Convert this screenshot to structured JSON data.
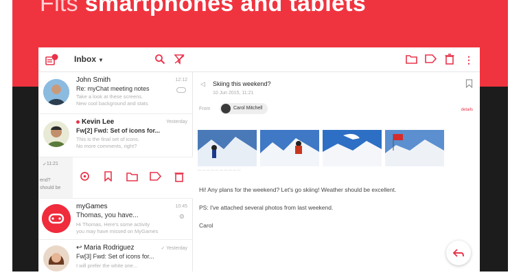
{
  "banner": {
    "headline_light": "Fits",
    "headline_bold": "smartphones and tablets"
  },
  "toolbar": {
    "folder_label": "Inbox",
    "icons": [
      "compose-badge-icon",
      "search-icon",
      "filter-icon",
      "folder-icon",
      "label-icon",
      "trash-icon",
      "more-icon"
    ]
  },
  "messages": [
    {
      "sender": "John Smith",
      "time": "12:12",
      "subject": "Re: myChat meeting notes",
      "preview_1": "Take a look at these screens.",
      "preview_2": "New cool background and stats"
    },
    {
      "sender": "Kevin Lee",
      "time": "Yesterday",
      "subject": "Fw[2] Fwd: Set of icons for...",
      "preview_1": "This is the final set of icons.",
      "preview_2": "No more comments, right?"
    },
    {
      "swipe_time": "11:21",
      "swipe_text_1": "end?",
      "swipe_text_2": "should be"
    },
    {
      "sender": "myGames",
      "time": "10:45",
      "subject": "Thomas, you have...",
      "preview_1": "Hi Thomas, Here's some activity",
      "preview_2": "you may have missed on MyGames"
    },
    {
      "sender": "Maria Rodriguez",
      "time": "Yesterday",
      "subject": "Fw[3] Fwd: Set of icons for...",
      "preview_1": "I will prefer the white one..."
    }
  ],
  "reader": {
    "subject": "Skiing this weekend?",
    "date": "10 Jun 2015, 11:21",
    "from_label": "From",
    "from_name": "Carol Mitchell",
    "details_label": "details",
    "body": [
      "Hi! Any plans for the weekend? Let's go skiing! Weather should be excellent.",
      "PS: I've attached several photos from last weekend.",
      "Carol"
    ]
  },
  "colors": {
    "accent": "#f0343f",
    "dark_band": "#1c1c1c"
  }
}
